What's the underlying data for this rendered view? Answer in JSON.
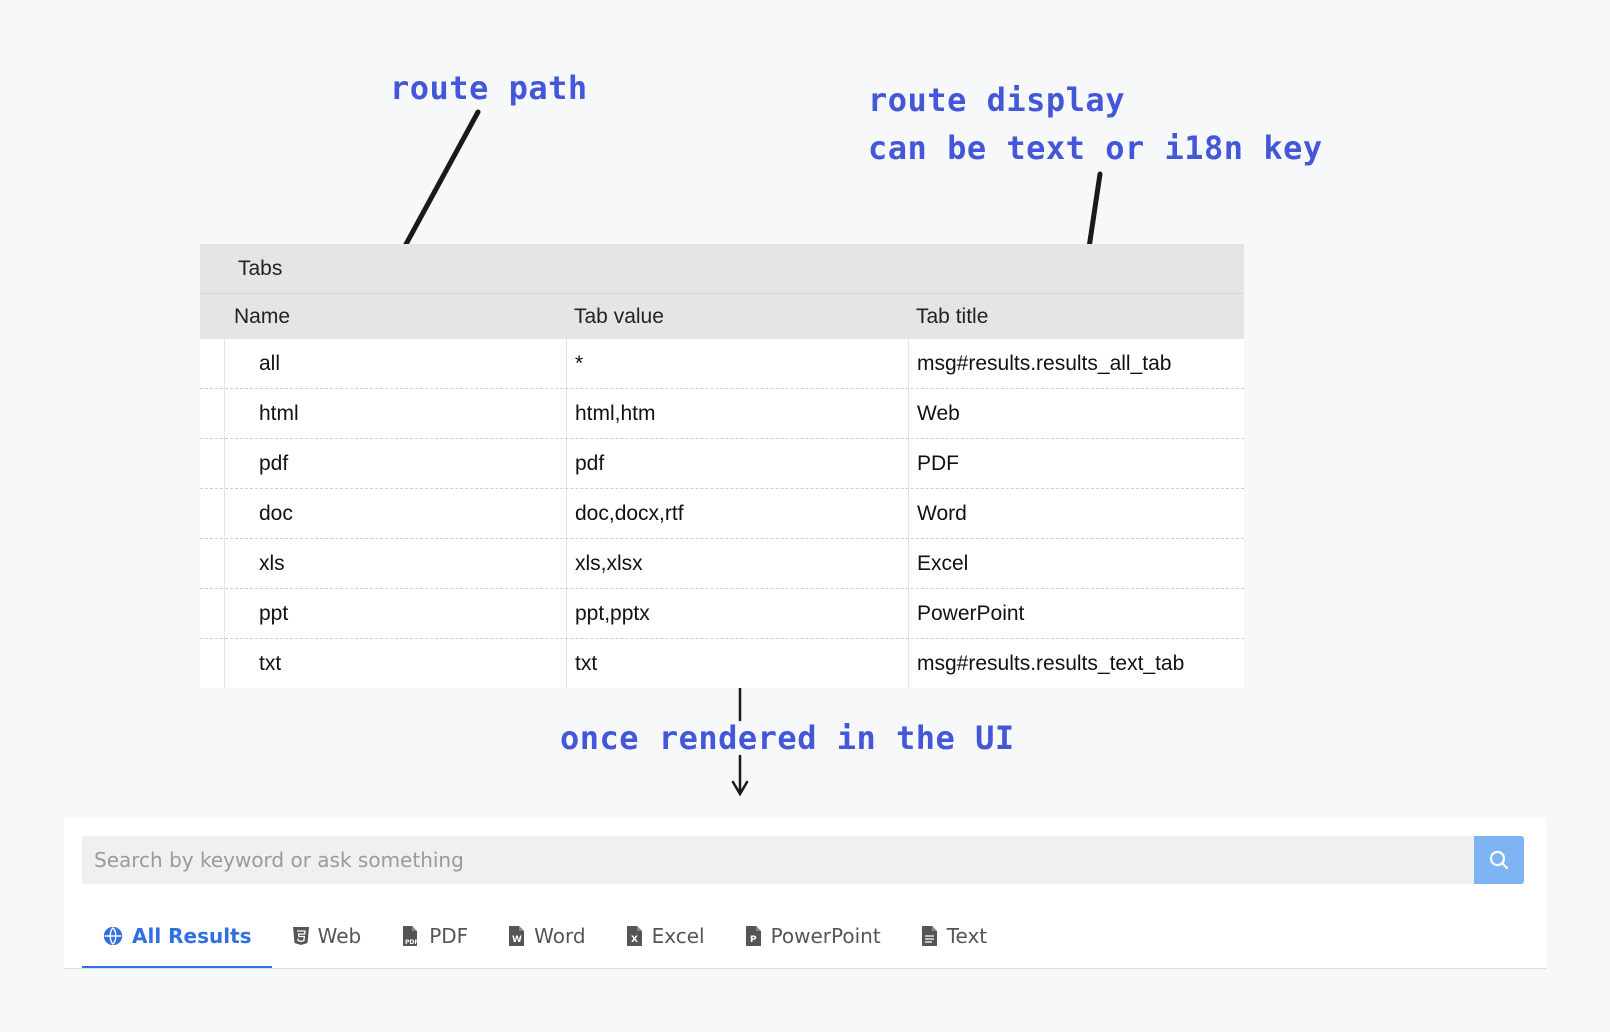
{
  "annotations": {
    "route_path": "route path",
    "route_display_line1": "route display",
    "route_display_line2": "can be text or i18n key",
    "rendered": "once rendered in the UI"
  },
  "config_table": {
    "caption": "Tabs",
    "columns": [
      "Name",
      "Tab value",
      "Tab title"
    ],
    "rows": [
      {
        "name": "all",
        "value": "*",
        "title": "msg#results.results_all_tab"
      },
      {
        "name": "html",
        "value": "html,htm",
        "title": "Web"
      },
      {
        "name": "pdf",
        "value": "pdf",
        "title": "PDF"
      },
      {
        "name": "doc",
        "value": "doc,docx,rtf",
        "title": "Word"
      },
      {
        "name": "xls",
        "value": "xls,xlsx",
        "title": "Excel"
      },
      {
        "name": "ppt",
        "value": "ppt,pptx",
        "title": "PowerPoint"
      },
      {
        "name": "txt",
        "value": "txt",
        "title": "msg#results.results_text_tab"
      }
    ]
  },
  "search": {
    "placeholder": "Search by keyword or ask something",
    "button_icon": "search-icon"
  },
  "tabs": [
    {
      "label": "All Results",
      "icon": "globe-icon",
      "active": true
    },
    {
      "label": "Web",
      "icon": "html5-icon",
      "active": false
    },
    {
      "label": "PDF",
      "icon": "pdf-file-icon",
      "active": false
    },
    {
      "label": "Word",
      "icon": "word-file-icon",
      "active": false
    },
    {
      "label": "Excel",
      "icon": "excel-file-icon",
      "active": false
    },
    {
      "label": "PowerPoint",
      "icon": "powerpoint-file-icon",
      "active": false
    },
    {
      "label": "Text",
      "icon": "text-file-icon",
      "active": false
    }
  ],
  "colors": {
    "annotation": "#4357d8",
    "accent": "#2f6fe0",
    "search_button": "#7eb4f4"
  }
}
